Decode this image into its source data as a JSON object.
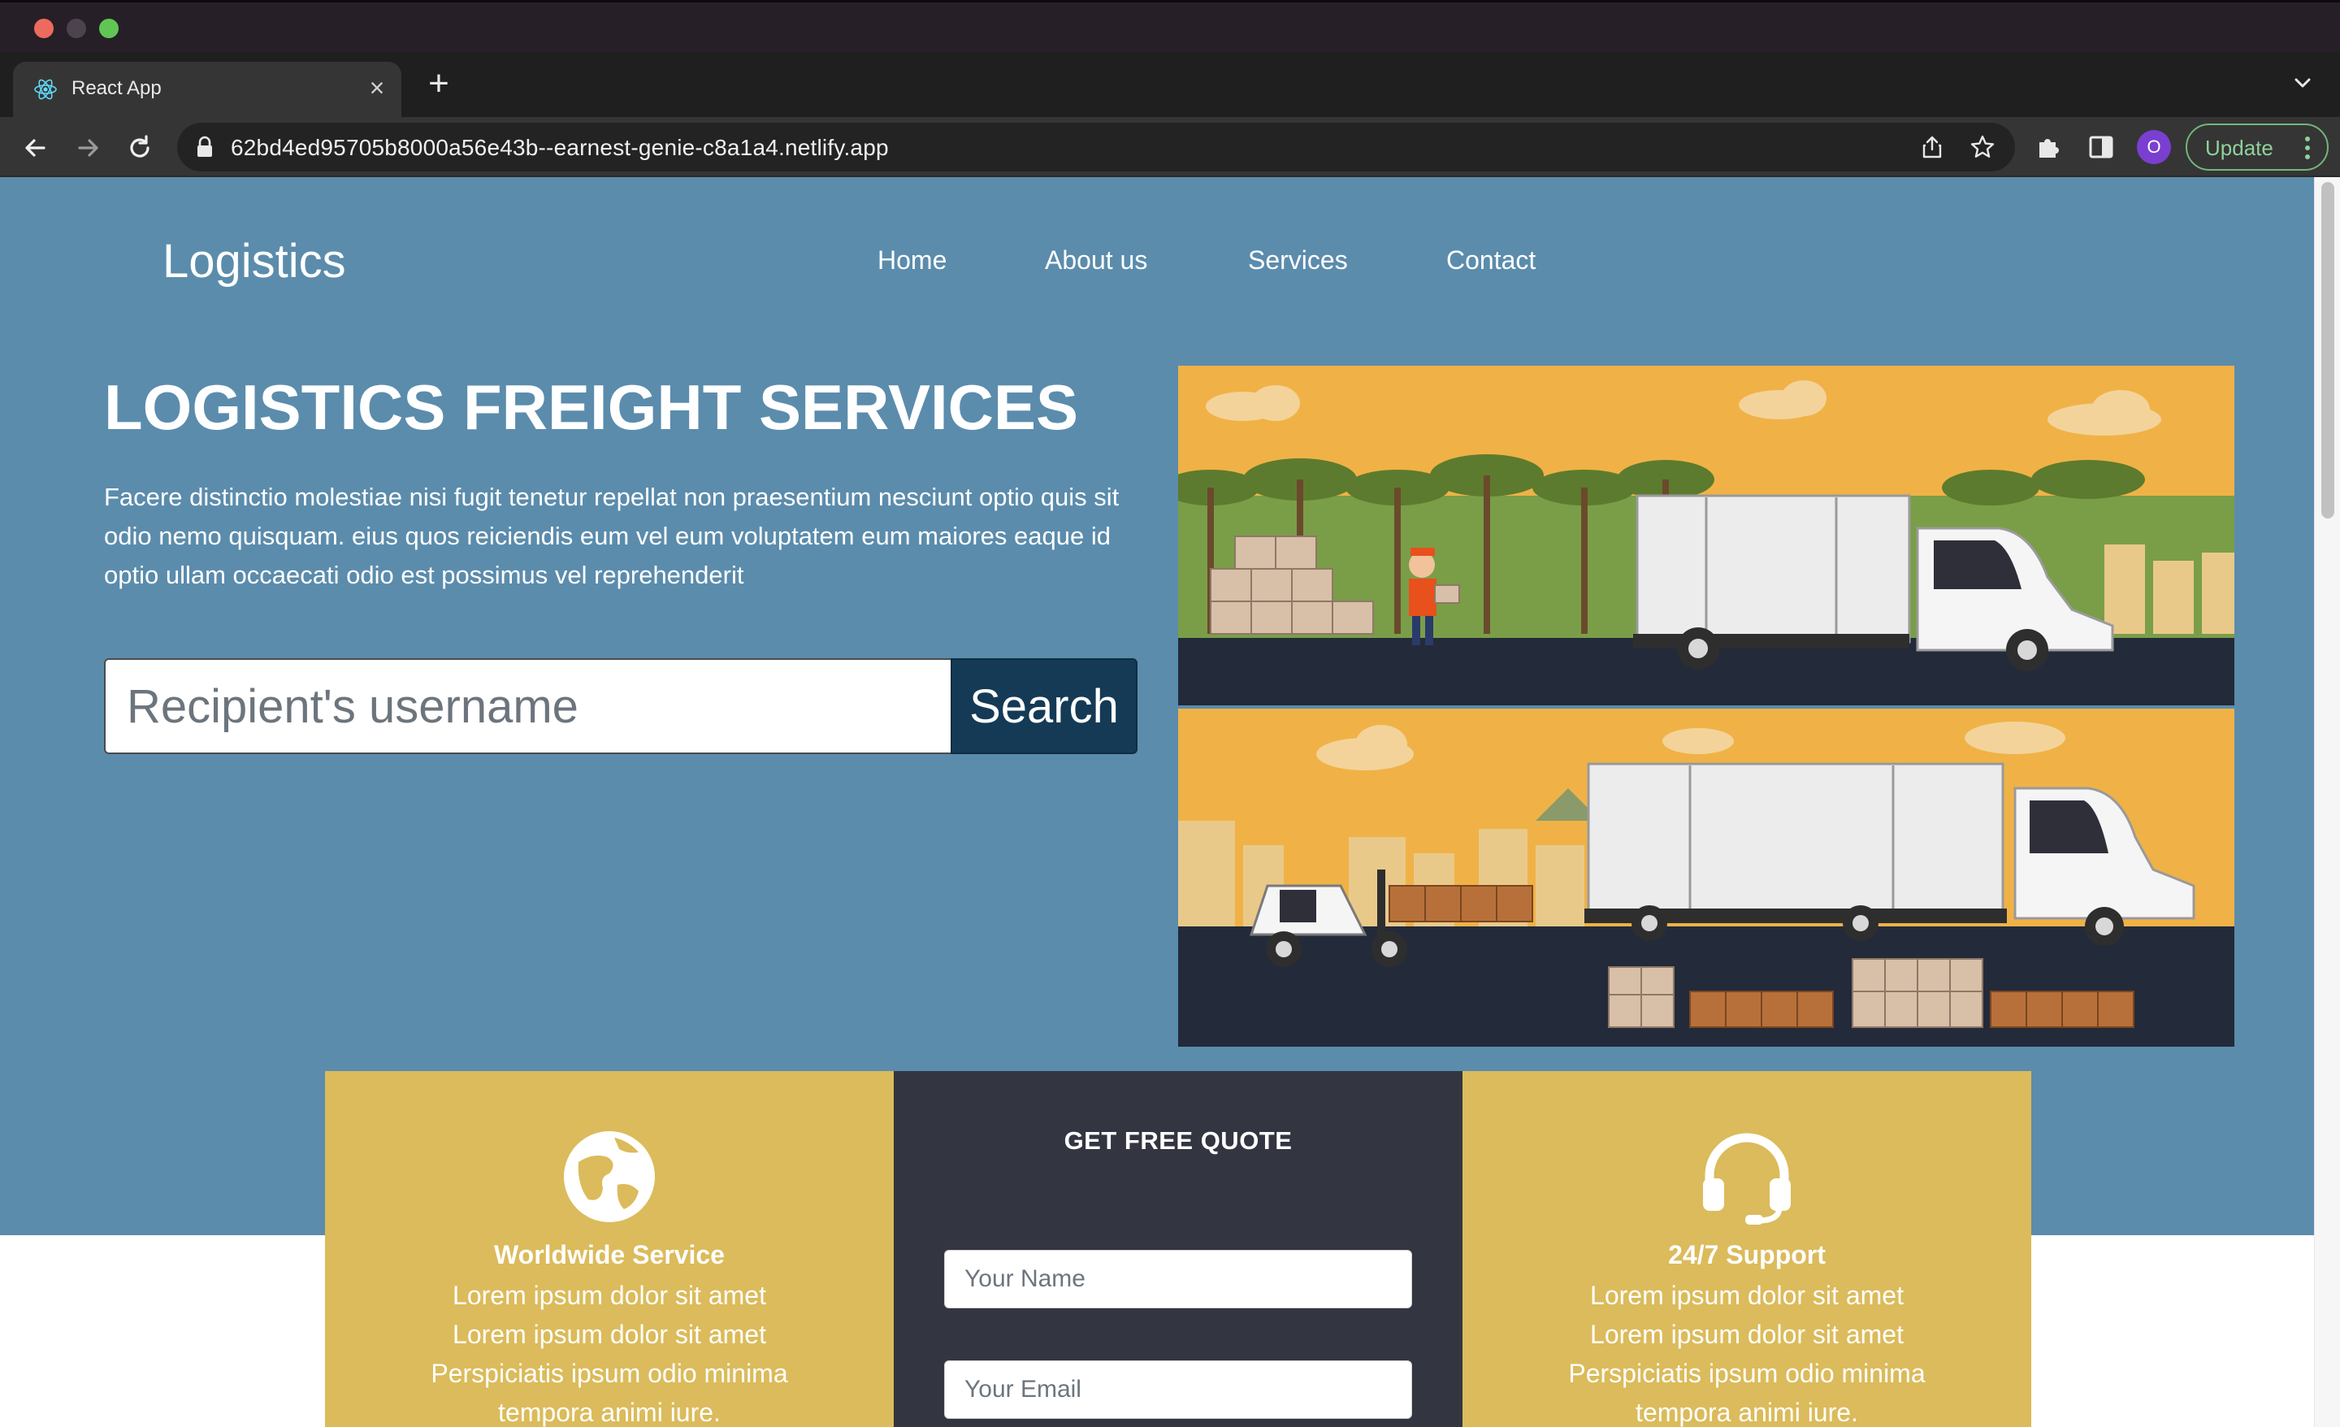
{
  "browser": {
    "tab_title": "React App",
    "url": "62bd4ed95705b8000a56e43b--earnest-genie-c8a1a4.netlify.app",
    "profile_initial": "O",
    "update_label": "Update",
    "icons": [
      "react-favicon-icon",
      "close-icon",
      "plus-icon",
      "chevron-down-icon",
      "back-arrow-icon",
      "forward-arrow-icon",
      "reload-icon",
      "lock-icon",
      "share-icon",
      "star-icon",
      "extensions-puzzle-icon",
      "side-panel-icon",
      "kebab-menu-icon"
    ]
  },
  "site": {
    "brand": "Logistics",
    "nav": [
      "Home",
      "About us",
      "Services",
      "Contact"
    ],
    "hero": {
      "title": "LOGISTICS FREIGHT SERVICES",
      "description": "Facere distinctio molestiae nisi fugit tenetur repellat non praesentium nesciunt optio quis sit odio nemo quisquam. eius quos reiciendis eum vel eum voluptatem eum maiores eaque id optio ullam occaecati odio est possimus vel reprehenderit",
      "search_placeholder": "Recipient's username",
      "search_button": "Search"
    },
    "cards": {
      "worldwide": {
        "title": "Worldwide Service",
        "lines": [
          "Lorem ipsum dolor sit amet",
          "Lorem ipsum dolor sit amet",
          "Perspiciatis ipsum odio minima",
          "tempora animi iure."
        ]
      },
      "quote": {
        "title": "GET FREE QUOTE",
        "name_placeholder": "Your Name",
        "email_placeholder": "Your Email"
      },
      "support": {
        "title": "24/7 Support",
        "lines": [
          "Lorem ipsum dolor sit amet",
          "Lorem ipsum dolor sit amet",
          "Perspiciatis ipsum odio minima",
          "tempora animi iure."
        ]
      }
    }
  },
  "colors": {
    "hero_bg": "#5b8cac",
    "search_button": "#143a56",
    "card_yellow": "#dbbb5b",
    "card_dark": "#333540",
    "illustration_sky": "#f0b246",
    "illustration_road": "#232a3a"
  }
}
